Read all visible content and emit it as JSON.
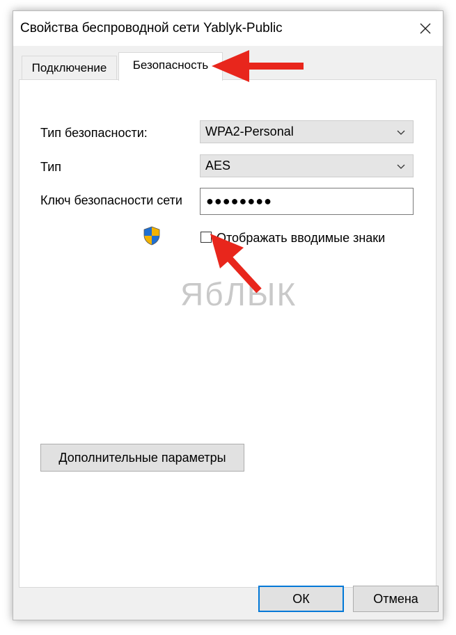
{
  "window": {
    "title": "Свойства беспроводной сети Yablyk-Public"
  },
  "tabs": [
    {
      "label": "Подключение",
      "active": false
    },
    {
      "label": "Безопасность",
      "active": true
    }
  ],
  "security": {
    "type_label": "Тип безопасности:",
    "type_value": "WPA2-Personal",
    "encryption_label": "Тип",
    "encryption_value": "AES",
    "key_label": "Ключ безопасности сети",
    "key_value": "●●●●●●●●",
    "show_chars_label": "Отображать вводимые знаки",
    "show_chars_checked": false
  },
  "watermark": "ЯбЛЫК",
  "buttons": {
    "advanced": "Дополнительные параметры",
    "ok": "ОК",
    "cancel": "Отмена"
  },
  "colors": {
    "annotation_arrow": "#e8261c",
    "default_button_border": "#0078d7"
  },
  "icons": [
    "close-icon",
    "chevron-down-icon",
    "uac-shield-icon",
    "annotation-arrow"
  ]
}
